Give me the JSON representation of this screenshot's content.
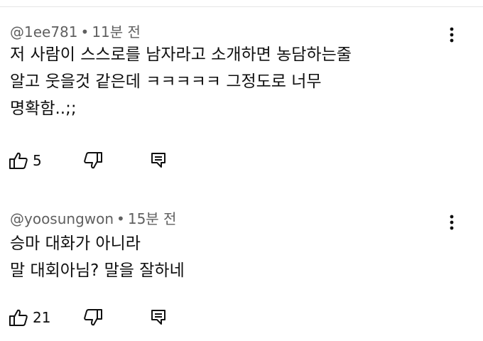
{
  "comments": [
    {
      "handle": "@1ee781",
      "separator": "•",
      "time": "11분 전",
      "lines": [
        "저 사람이 스스로를 남자라고 소개하면 농담하는줄",
        "알고 웃을것 같은데 ㅋㅋㅋㅋㅋ 그정도로 너무",
        "명확함..;;"
      ],
      "likes": "5",
      "icons": {
        "like": "thumbs-up-icon",
        "dislike": "thumbs-down-icon",
        "reply": "reply-icon",
        "menu": "more-vertical-icon"
      }
    },
    {
      "handle": "@yoosungwon",
      "separator": "•",
      "time": "15분 전",
      "lines": [
        "승마 대화가 아니라",
        "말 대회아님? 말을 잘하네"
      ],
      "likes": "21",
      "icons": {
        "like": "thumbs-up-icon",
        "dislike": "thumbs-down-icon",
        "reply": "reply-icon",
        "menu": "more-vertical-icon"
      }
    }
  ],
  "colors": {
    "meta_text": "#606060",
    "body_text": "#0f0f0f",
    "icon": "#0f0f0f",
    "divider": "#e5e5e5"
  }
}
